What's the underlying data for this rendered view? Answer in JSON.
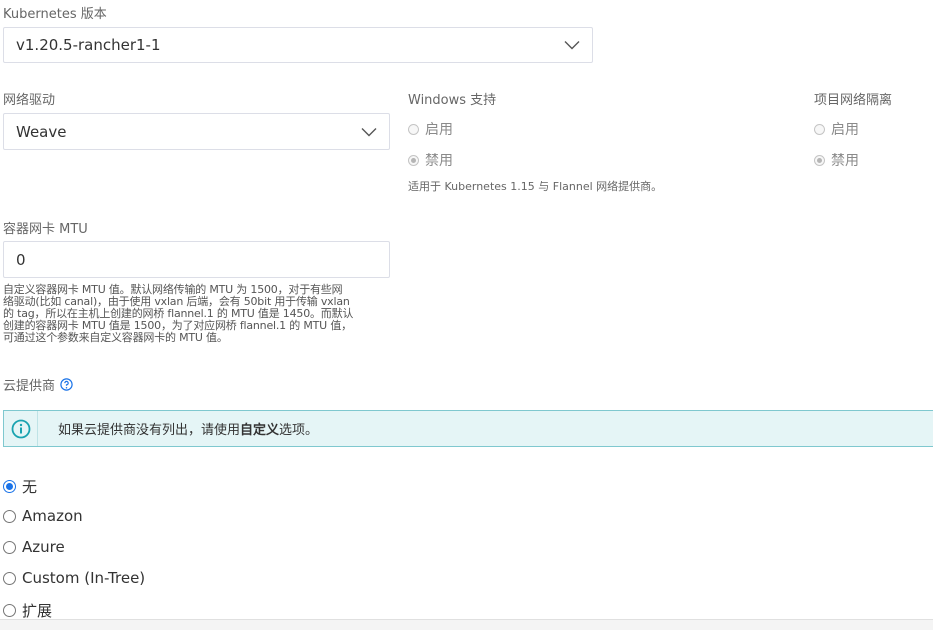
{
  "k8s": {
    "label": "Kubernetes 版本",
    "value": "v1.20.5-rancher1-1"
  },
  "network": {
    "label": "网络驱动",
    "value": "Weave"
  },
  "windows": {
    "label": "Windows 支持",
    "options": [
      "启用",
      "禁用"
    ],
    "selected": "禁用",
    "note": "适用于 Kubernetes 1.15 与 Flannel 网络提供商。"
  },
  "isolation": {
    "label": "项目网络隔离",
    "options": [
      "启用",
      "禁用"
    ],
    "selected": "禁用"
  },
  "mtu": {
    "label": "容器网卡 MTU",
    "value": "0",
    "help_lines": [
      "自定义容器网卡 MTU 值。默认网络传输的 MTU 为 1500，对于有些网",
      "络驱动(比如 canal)，由于使用 vxlan 后端，会有 50bit 用于传输 vxlan",
      "的 tag，所以在主机上创建的网桥 flannel.1 的 MTU 值是 1450。而默认",
      "创建的容器网卡 MTU 值是 1500，为了对应网桥 flannel.1 的 MTU 值，",
      "可通过这个参数来自定义容器网卡的 MTU 值。"
    ]
  },
  "cloud": {
    "label": "云提供商",
    "banner_prefix": "如果云提供商没有列出，请使用",
    "banner_bold": "自定义",
    "banner_suffix": "选项。",
    "options": [
      "无",
      "Amazon",
      "Azure",
      "Custom (In-Tree)",
      "扩展"
    ],
    "selected": "无"
  },
  "colors": {
    "accent": "#1a73e8",
    "info": "#1aa3b0",
    "banner_bg": "#e5f5f6"
  },
  "icons": {
    "dropdown": "chevron-down-icon",
    "help": "question-circle-icon",
    "info": "info-circle-icon"
  }
}
